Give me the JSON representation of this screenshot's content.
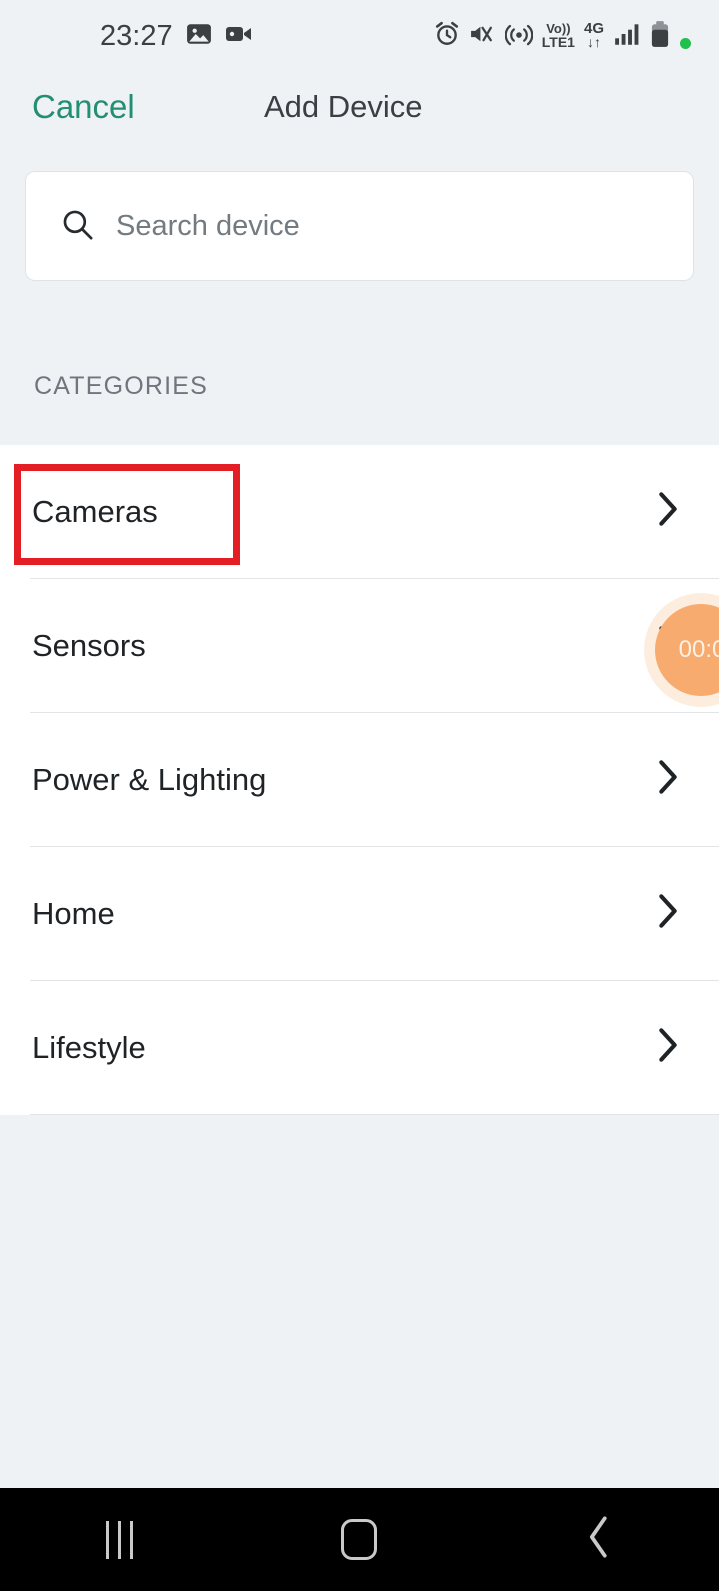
{
  "status_bar": {
    "time": "23:27",
    "left_icons": [
      "image-icon",
      "video-camera-icon"
    ],
    "right_icons": [
      "alarm-icon",
      "mute-vibrate-icon",
      "hotspot-icon",
      "volte-icon",
      "network-4g-icon",
      "signal-bars-icon",
      "battery-icon",
      "green-dot-indicator"
    ],
    "volte_line1": "Vo))",
    "volte_line2": "LTE1",
    "network_line1": "4G",
    "network_line2": "↓↑"
  },
  "header": {
    "cancel_label": "Cancel",
    "title": "Add Device"
  },
  "search": {
    "placeholder": "Search device",
    "value": ""
  },
  "section": {
    "categories_label": "CATEGORIES"
  },
  "categories": [
    {
      "label": "Cameras",
      "chevron": "chevron-right-icon"
    },
    {
      "label": "Sensors",
      "chevron": "chevron-right-icon"
    },
    {
      "label": "Power & Lighting",
      "chevron": "chevron-right-icon"
    },
    {
      "label": "Home",
      "chevron": "chevron-right-icon"
    },
    {
      "label": "Lifestyle",
      "chevron": "chevron-right-icon"
    }
  ],
  "recording_badge": {
    "timer": "00:0"
  },
  "nav_bar": {
    "recents_label": "recents-icon",
    "home_label": "home-icon",
    "back_label": "back-icon"
  },
  "colors": {
    "accent_teal": "#238f72",
    "annotation_red": "#e31e24",
    "badge_orange": "#f7ab6e",
    "page_bg": "#eff2f5",
    "list_bg": "#ffffff"
  }
}
